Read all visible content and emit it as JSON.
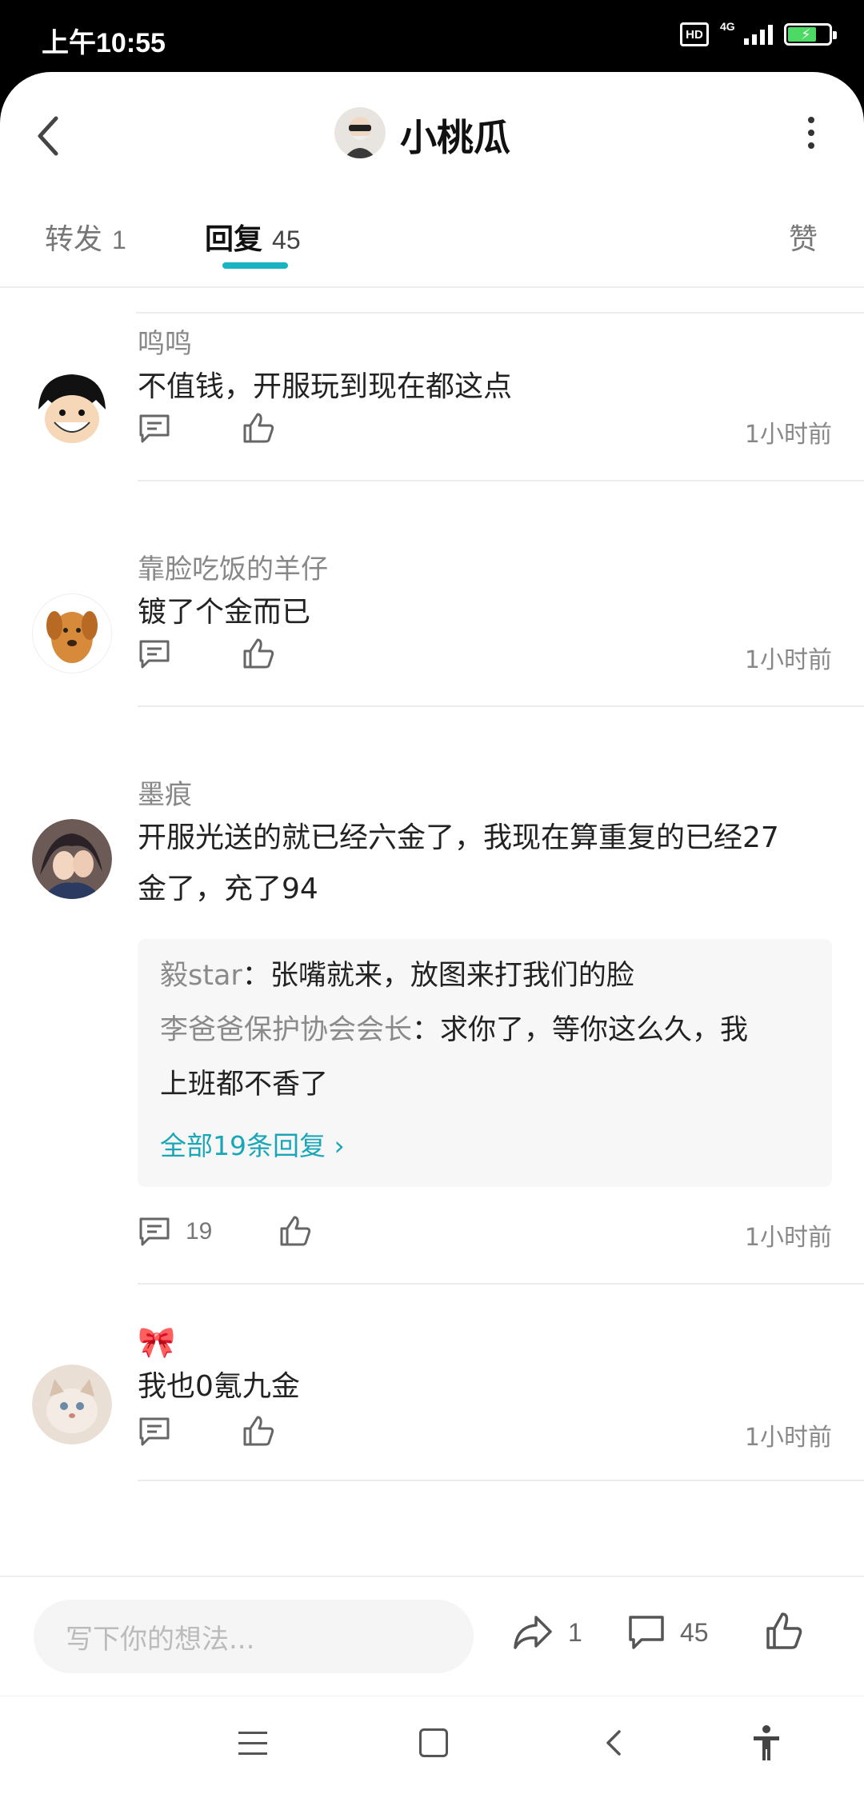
{
  "status": {
    "time": "上午10:55",
    "network": "4G",
    "hd": "HD"
  },
  "header": {
    "title": "小桃瓜"
  },
  "tabs": [
    {
      "label": "转发",
      "count": "1"
    },
    {
      "label": "回复",
      "count": "45"
    },
    {
      "label": "赞",
      "count": ""
    }
  ],
  "comments": [
    {
      "name": "鸣鸣",
      "text": "不值钱，开服玩到现在都这点",
      "time": "1小时前",
      "reply_count": ""
    },
    {
      "name": "靠脸吃饭的羊仔",
      "text": "镀了个金而已",
      "time": "1小时前",
      "reply_count": ""
    },
    {
      "name": "墨痕",
      "text_line1": "开服光送的就已经六金了，我现在算重复的已经27",
      "text_line2": "金了，充了94",
      "time": "1小时前",
      "reply_count": "19",
      "replies": [
        {
          "author": "毅star",
          "sep": "：",
          "text": "张嘴就来，放图来打我们的脸"
        },
        {
          "author": "李爸爸保护协会会长",
          "sep": "：",
          "text": "求你了，等你这么久，我",
          "text_cont": "上班都不香了"
        }
      ],
      "more_replies": "全部19条回复 ›"
    },
    {
      "name": "🎀",
      "text": "我也0氪九金",
      "time": "1小时前",
      "reply_count": ""
    }
  ],
  "bottom_bar": {
    "placeholder": "写下你的想法...",
    "share_count": "1",
    "comment_count": "45"
  },
  "colors": {
    "accent": "#1ab3c2",
    "link": "#1ba6b8"
  }
}
